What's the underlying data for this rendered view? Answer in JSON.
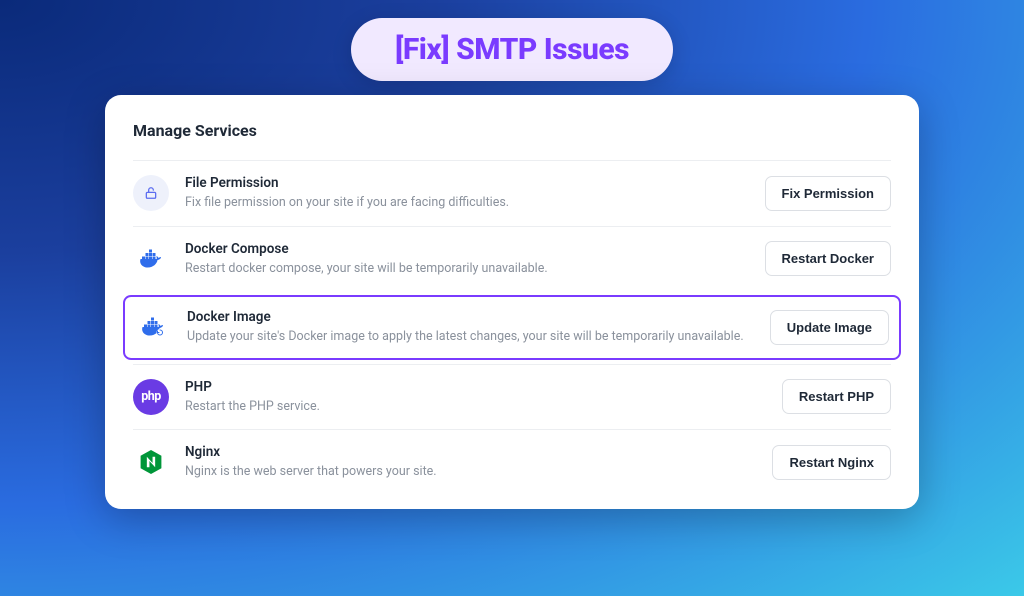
{
  "hero": {
    "title": "[Fix] SMTP Issues"
  },
  "card": {
    "title": "Manage Services",
    "rows": [
      {
        "icon": "unlock-icon",
        "title": "File Permission",
        "desc": "Fix file permission on your site if you are facing difficulties.",
        "button": "Fix Permission",
        "highlight": false
      },
      {
        "icon": "docker-icon",
        "title": "Docker Compose",
        "desc": "Restart docker compose, your site will be temporarily unavailable.",
        "button": "Restart Docker",
        "highlight": false
      },
      {
        "icon": "docker-sync-icon",
        "title": "Docker Image",
        "desc": "Update your site's Docker image to apply the latest changes, your site will be temporarily unavailable.",
        "button": "Update Image",
        "highlight": true
      },
      {
        "icon": "php-icon",
        "title": "PHP",
        "desc": "Restart the PHP service.",
        "button": "Restart PHP",
        "highlight": false
      },
      {
        "icon": "nginx-icon",
        "title": "Nginx",
        "desc": "Nginx is the web server that powers your site.",
        "button": "Restart Nginx",
        "highlight": false
      }
    ]
  },
  "colors": {
    "accent": "#7a3bff",
    "docker_blue": "#2f6deb",
    "nginx_green": "#009639",
    "php_purple": "#6a3be4"
  }
}
